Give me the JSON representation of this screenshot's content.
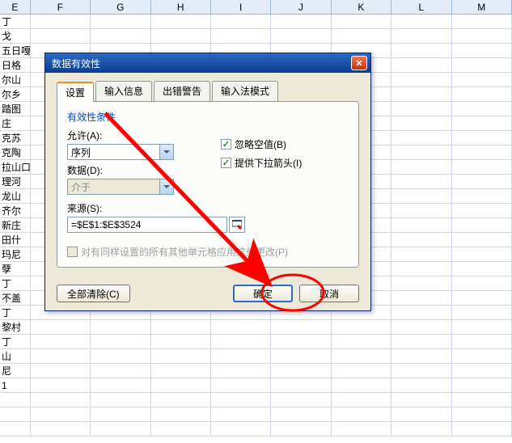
{
  "columns": [
    "E",
    "F",
    "G",
    "H",
    "I",
    "J",
    "K",
    "L",
    "M"
  ],
  "colE_values": [
    "丁",
    "戈",
    "五日嘎",
    "日格",
    "尔山",
    "尔乡",
    "踏图",
    "庄",
    "克苏",
    "克陶",
    "拉山口",
    "理河",
    "龙山",
    "齐尔",
    "新庄",
    "田什",
    "玛尼",
    "孽",
    "丁",
    "不盖",
    "丁",
    "黎村",
    "丁",
    "山",
    "尼",
    "1"
  ],
  "dialog": {
    "title": "数据有效性",
    "tabs": {
      "t1": "设置",
      "t2": "输入信息",
      "t3": "出错警告",
      "t4": "输入法模式"
    },
    "group_title": "有效性条件",
    "allow_label": "允许(A):",
    "allow_value": "序列",
    "data_label": "数据(D):",
    "data_value": "介于",
    "ignore_blank_label": "忽略空值(B)",
    "dropdown_label": "提供下拉箭头(I)",
    "source_label": "来源(S):",
    "source_value": "=$E$1:$E$3524",
    "apply_label": "对有同样设置的所有其他单元格应用这些更改(P)",
    "clear_btn": "全部清除(C)",
    "ok_btn": "确定",
    "cancel_btn": "取消"
  }
}
